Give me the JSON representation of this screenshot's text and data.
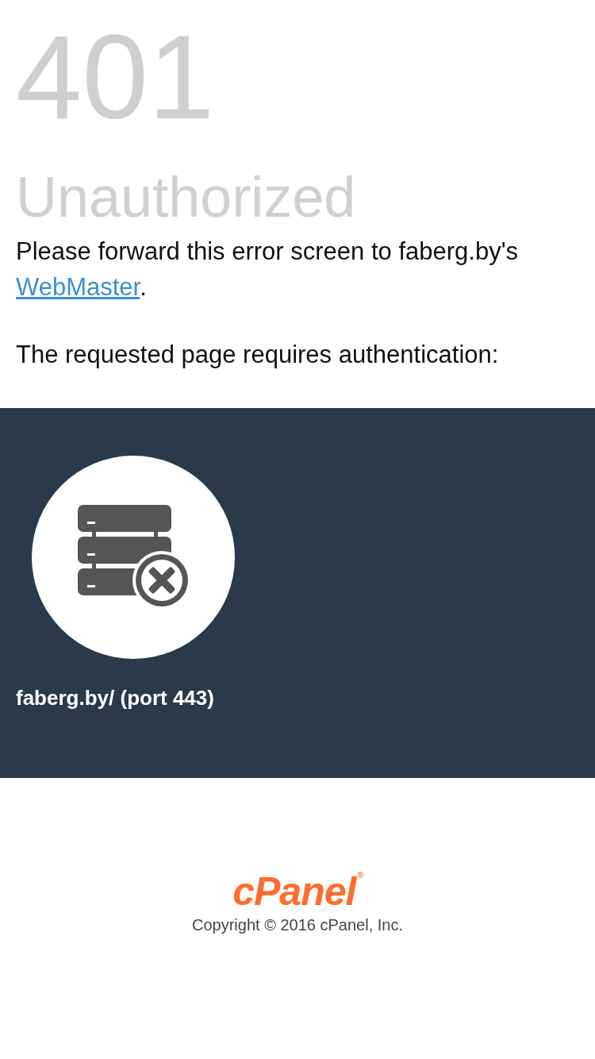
{
  "error": {
    "code": "401",
    "title": "Unauthorized"
  },
  "message": {
    "text": "Please forward this error screen to faberg.by's ",
    "link": "WebMaster",
    "end": "."
  },
  "detail": "The requested page requires authentication:",
  "panel": {
    "host": "faberg.by/ (port 443)"
  },
  "footer": {
    "logo": "cPanel",
    "registered": "®",
    "copyright": "Copyright © 2016 cPanel, Inc."
  }
}
